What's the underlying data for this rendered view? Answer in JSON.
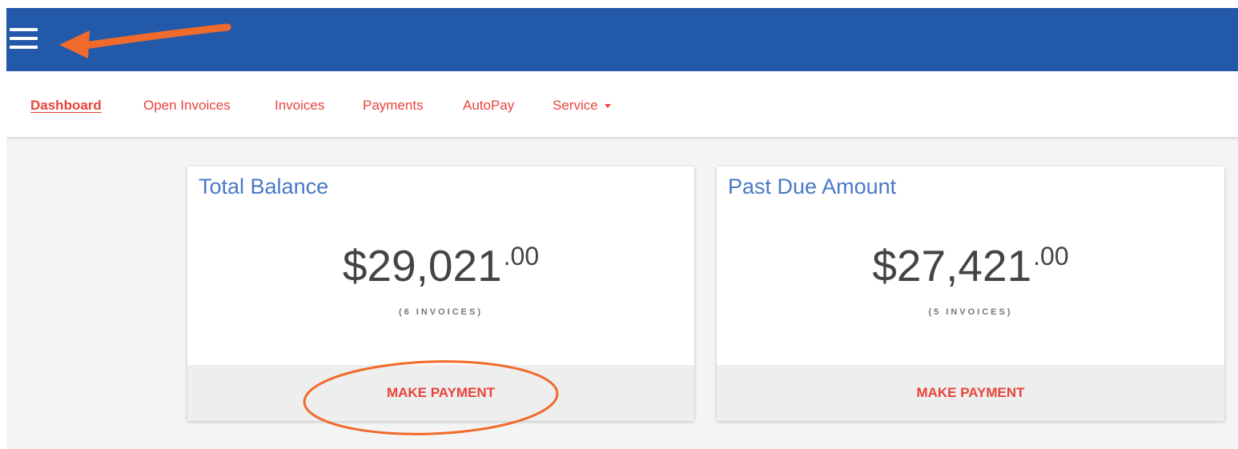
{
  "nav": {
    "items": [
      {
        "label": "Dashboard",
        "active": true
      },
      {
        "label": "Open Invoices"
      },
      {
        "label": "Invoices"
      },
      {
        "label": "Payments"
      },
      {
        "label": "AutoPay"
      },
      {
        "label": "Service"
      }
    ]
  },
  "cards": [
    {
      "title": "Total Balance",
      "amount_main": "$29,021",
      "amount_cents": ".00",
      "count": "(6 INVOICES)",
      "button": "MAKE PAYMENT"
    },
    {
      "title": "Past Due Amount",
      "amount_main": "$27,421",
      "amount_cents": ".00",
      "count": "(5 INVOICES)",
      "button": "MAKE PAYMENT"
    }
  ],
  "colors": {
    "header": "#2259a8",
    "accent": "#e8443a",
    "title": "#4a78c6",
    "annotation": "#f06b2b"
  },
  "icons": {
    "menu": "hamburger-menu-icon",
    "dropdown": "caret-down-icon"
  }
}
